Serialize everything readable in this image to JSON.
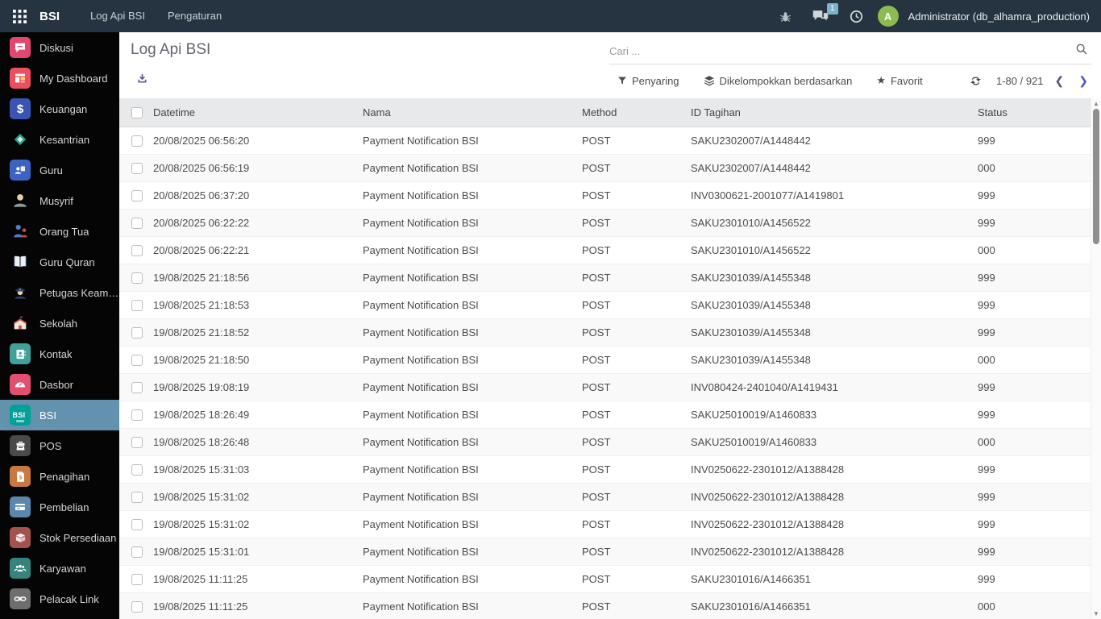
{
  "topbar": {
    "app_name": "BSI",
    "menu_items": [
      "Log Api BSI",
      "Pengaturan"
    ],
    "notification_count": "1",
    "avatar_letter": "A",
    "user": "Administrator (db_alhamra_production)"
  },
  "sidebar": {
    "active": "BSI",
    "items": [
      {
        "label": "Diskusi",
        "icon": "chat-icon",
        "color": "#e0486f"
      },
      {
        "label": "My Dashboard",
        "icon": "dashboard-icon",
        "color": "#ef4e5e"
      },
      {
        "label": "Keuangan",
        "icon": "finance-icon",
        "color": "#3a54b4"
      },
      {
        "label": "Kesantrian",
        "icon": "ornament-icon",
        "color": "transparent"
      },
      {
        "label": "Guru",
        "icon": "teacher-icon",
        "color": "#3c63c4"
      },
      {
        "label": "Musyrif",
        "icon": "person-icon",
        "color": "transparent"
      },
      {
        "label": "Orang Tua",
        "icon": "parents-icon",
        "color": "transparent"
      },
      {
        "label": "Guru Quran",
        "icon": "book-icon",
        "color": "transparent"
      },
      {
        "label": "Petugas Keam…",
        "icon": "police-icon",
        "color": "transparent"
      },
      {
        "label": "Sekolah",
        "icon": "school-icon",
        "color": "transparent"
      },
      {
        "label": "Kontak",
        "icon": "contacts-icon",
        "color": "#40a09a"
      },
      {
        "label": "Dasbor",
        "icon": "gauge-icon",
        "color": "#e34f70"
      },
      {
        "label": "BSI",
        "icon": "bsi-icon",
        "color": "#00a19a"
      },
      {
        "label": "POS",
        "icon": "pos-icon",
        "color": "#4a4a4a"
      },
      {
        "label": "Penagihan",
        "icon": "invoice-icon",
        "color": "#c8793f"
      },
      {
        "label": "Pembelian",
        "icon": "purchase-icon",
        "color": "#5b87ad"
      },
      {
        "label": "Stok Persediaan",
        "icon": "inventory-icon",
        "color": "#a3524d"
      },
      {
        "label": "Karyawan",
        "icon": "employees-icon",
        "color": "#35837c"
      },
      {
        "label": "Pelacak Link",
        "icon": "link-icon",
        "color": "#6e6e6e"
      }
    ]
  },
  "content": {
    "title": "Log Api BSI",
    "search_placeholder": "Cari ...",
    "buttons": {
      "filter": "Penyaring",
      "groupby": "Dikelompokkan berdasarkan",
      "favorite": "Favorit"
    },
    "pager": "1-80 / 921"
  },
  "table": {
    "columns": [
      "Datetime",
      "Nama",
      "Method",
      "ID Tagihan",
      "Status"
    ],
    "rows": [
      [
        "20/08/2025 06:56:20",
        "Payment Notification BSI",
        "POST",
        "SAKU2302007/A1448442",
        "999"
      ],
      [
        "20/08/2025 06:56:19",
        "Payment Notification BSI",
        "POST",
        "SAKU2302007/A1448442",
        "000"
      ],
      [
        "20/08/2025 06:37:20",
        "Payment Notification BSI",
        "POST",
        "INV0300621-2001077/A1419801",
        "999"
      ],
      [
        "20/08/2025 06:22:22",
        "Payment Notification BSI",
        "POST",
        "SAKU2301010/A1456522",
        "999"
      ],
      [
        "20/08/2025 06:22:21",
        "Payment Notification BSI",
        "POST",
        "SAKU2301010/A1456522",
        "000"
      ],
      [
        "19/08/2025 21:18:56",
        "Payment Notification BSI",
        "POST",
        "SAKU2301039/A1455348",
        "999"
      ],
      [
        "19/08/2025 21:18:53",
        "Payment Notification BSI",
        "POST",
        "SAKU2301039/A1455348",
        "999"
      ],
      [
        "19/08/2025 21:18:52",
        "Payment Notification BSI",
        "POST",
        "SAKU2301039/A1455348",
        "999"
      ],
      [
        "19/08/2025 21:18:50",
        "Payment Notification BSI",
        "POST",
        "SAKU2301039/A1455348",
        "000"
      ],
      [
        "19/08/2025 19:08:19",
        "Payment Notification BSI",
        "POST",
        "INV080424-2401040/A1419431",
        "999"
      ],
      [
        "19/08/2025 18:26:49",
        "Payment Notification BSI",
        "POST",
        "SAKU25010019/A1460833",
        "999"
      ],
      [
        "19/08/2025 18:26:48",
        "Payment Notification BSI",
        "POST",
        "SAKU25010019/A1460833",
        "000"
      ],
      [
        "19/08/2025 15:31:03",
        "Payment Notification BSI",
        "POST",
        "INV0250622-2301012/A1388428",
        "999"
      ],
      [
        "19/08/2025 15:31:02",
        "Payment Notification BSI",
        "POST",
        "INV0250622-2301012/A1388428",
        "999"
      ],
      [
        "19/08/2025 15:31:02",
        "Payment Notification BSI",
        "POST",
        "INV0250622-2301012/A1388428",
        "999"
      ],
      [
        "19/08/2025 15:31:01",
        "Payment Notification BSI",
        "POST",
        "INV0250622-2301012/A1388428",
        "999"
      ],
      [
        "19/08/2025 11:11:25",
        "Payment Notification BSI",
        "POST",
        "SAKU2301016/A1466351",
        "999"
      ],
      [
        "19/08/2025 11:11:25",
        "Payment Notification BSI",
        "POST",
        "SAKU2301016/A1466351",
        "000"
      ]
    ]
  },
  "colors": {
    "topbar_bg": "#253440",
    "sidebar_active_bg": "#6292ad",
    "accent_purple": "#5e5890",
    "avatar_green": "#8cbb52",
    "badge_blue": "#7cb3cb"
  }
}
